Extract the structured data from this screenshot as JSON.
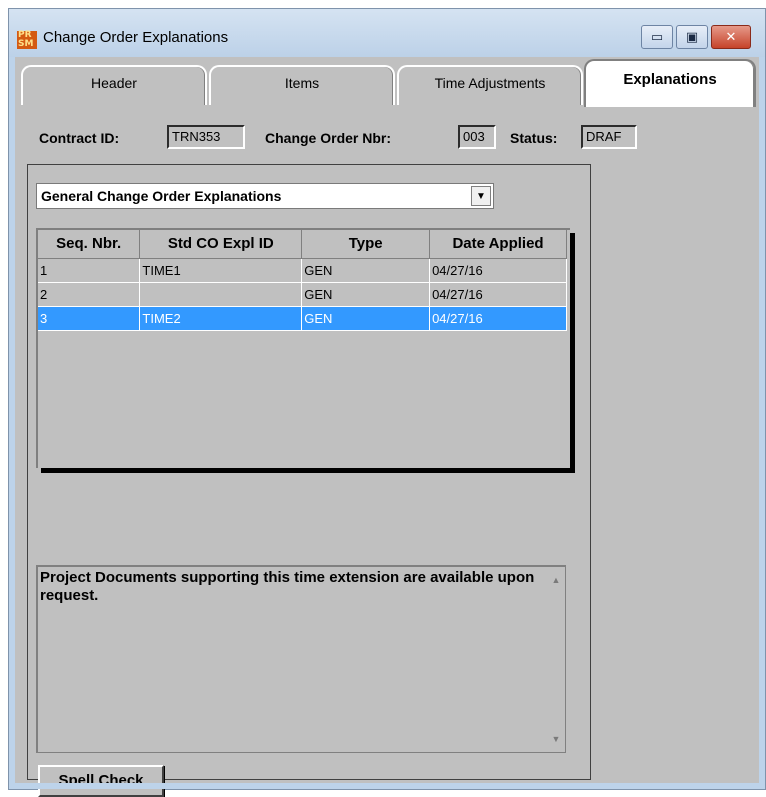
{
  "window": {
    "title": "Change Order Explanations",
    "icon_letters_top": "PR",
    "icon_letters_bottom": "SM",
    "min_glyph": "▭",
    "max_glyph": "▣",
    "close_glyph": "✕"
  },
  "tabs": [
    {
      "label": "Header"
    },
    {
      "label": "Items"
    },
    {
      "label": "Time Adjustments"
    },
    {
      "label": "Explanations",
      "active": true
    }
  ],
  "info": {
    "contract_label": "Contract ID:",
    "contract_value": "TRN353",
    "co_label": "Change Order Nbr:",
    "co_value": "003",
    "status_label": "Status:",
    "status_value": "DRAF"
  },
  "combo": {
    "value": "General Change Order Explanations",
    "arrow": "▼"
  },
  "grid": {
    "columns": [
      "Seq. Nbr.",
      "Std CO Expl ID",
      "Type",
      "Date Applied"
    ],
    "rows": [
      {
        "seq": "1",
        "expl_id": "TIME1",
        "type": "GEN",
        "date": "04/27/16"
      },
      {
        "seq": "2",
        "expl_id": "",
        "type": "GEN",
        "date": "04/27/16"
      },
      {
        "seq": "3",
        "expl_id": "TIME2",
        "type": "GEN",
        "date": "04/27/16",
        "selected": true
      }
    ]
  },
  "explanation": {
    "text": "Project Documents supporting this time extension are available upon request.",
    "scroll_up": "▲",
    "scroll_down": "▼"
  },
  "buttons": {
    "spell_check_prefix": "Spell Chec",
    "spell_check_accel": "k"
  }
}
